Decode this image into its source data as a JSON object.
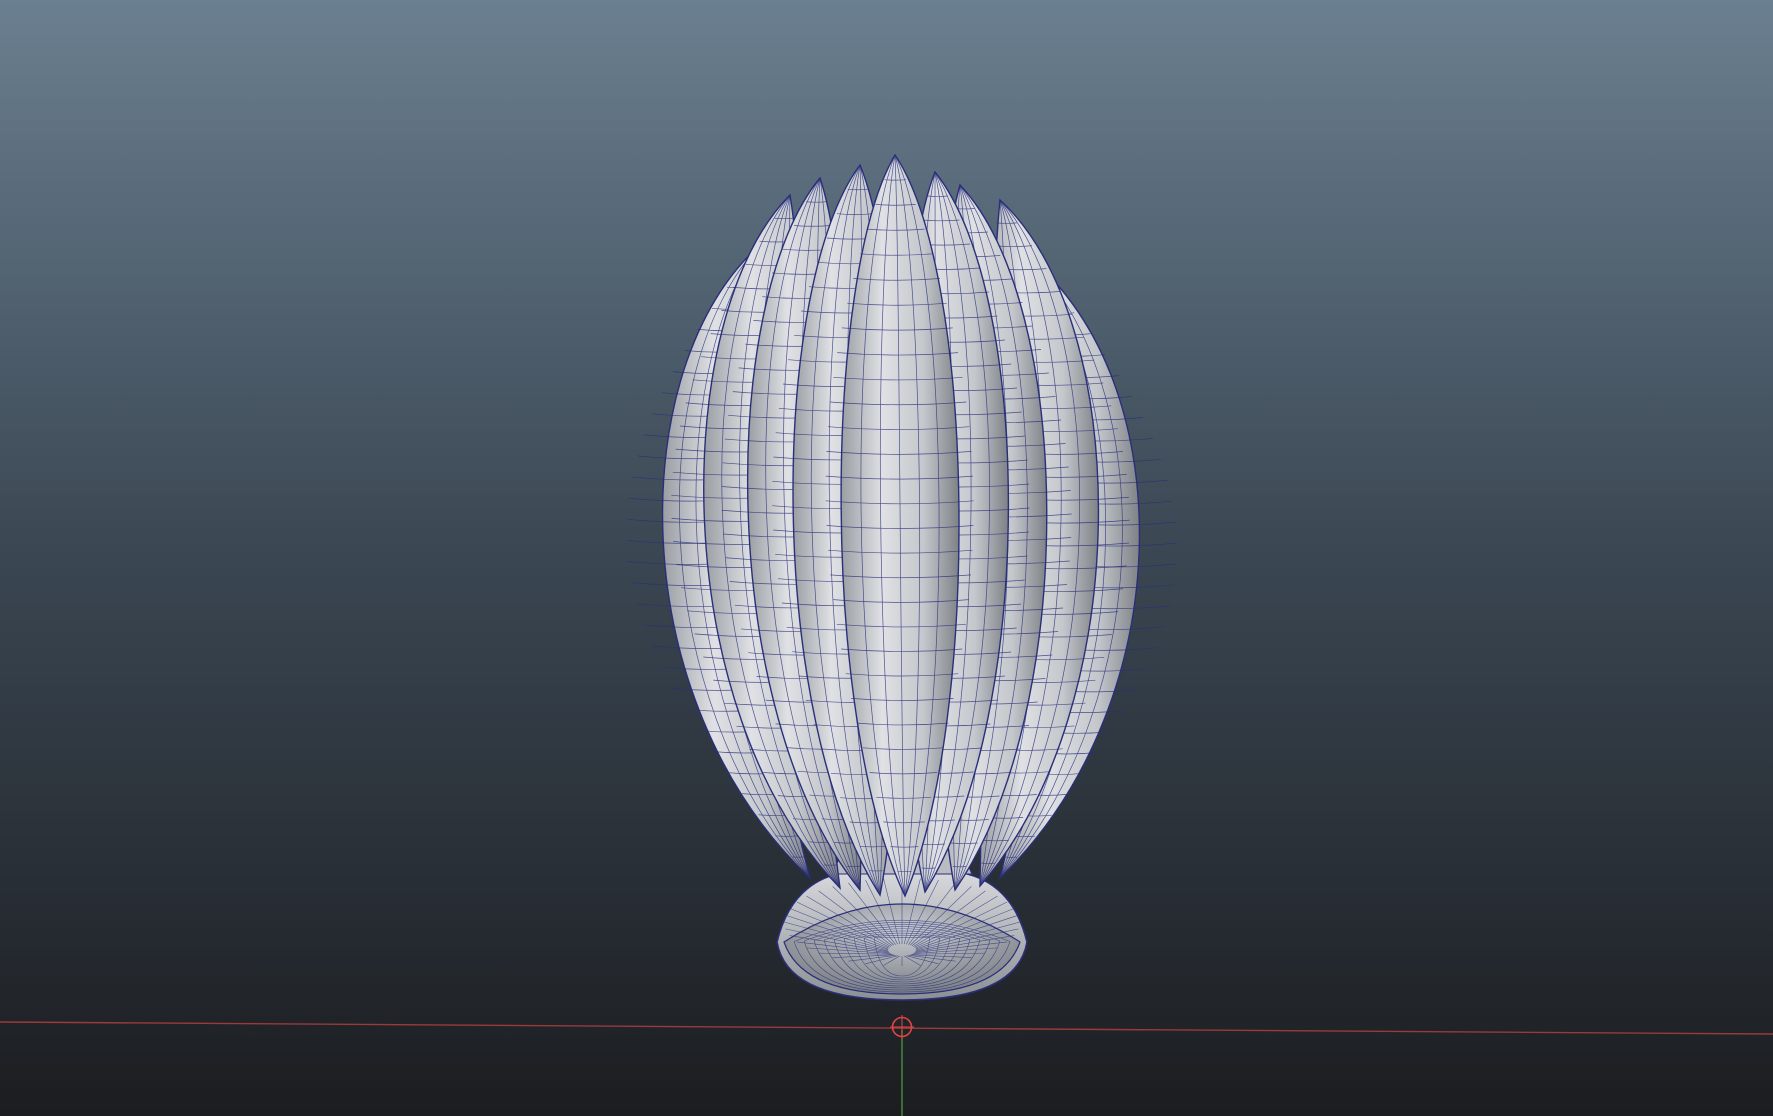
{
  "viewport": {
    "background_top": "#6a7f90",
    "background_middle": "#3a4652",
    "background_bottom": "#1b1d20",
    "colors": {
      "surface": "#c4c7cb",
      "surface_light": "#dfe1e4",
      "surface_shadow": "#7e8287",
      "wire": "#2a2f7a",
      "grid_x_axis": "#9a3a3a",
      "grid_y_axis": "#4b8f3c",
      "pivot_manipulator": "#e04545"
    },
    "objects": [
      {
        "name": "bud-petals",
        "petal_count": 9
      },
      {
        "name": "base-cup"
      }
    ],
    "icons": [
      "pivot-manipulator-icon"
    ]
  }
}
